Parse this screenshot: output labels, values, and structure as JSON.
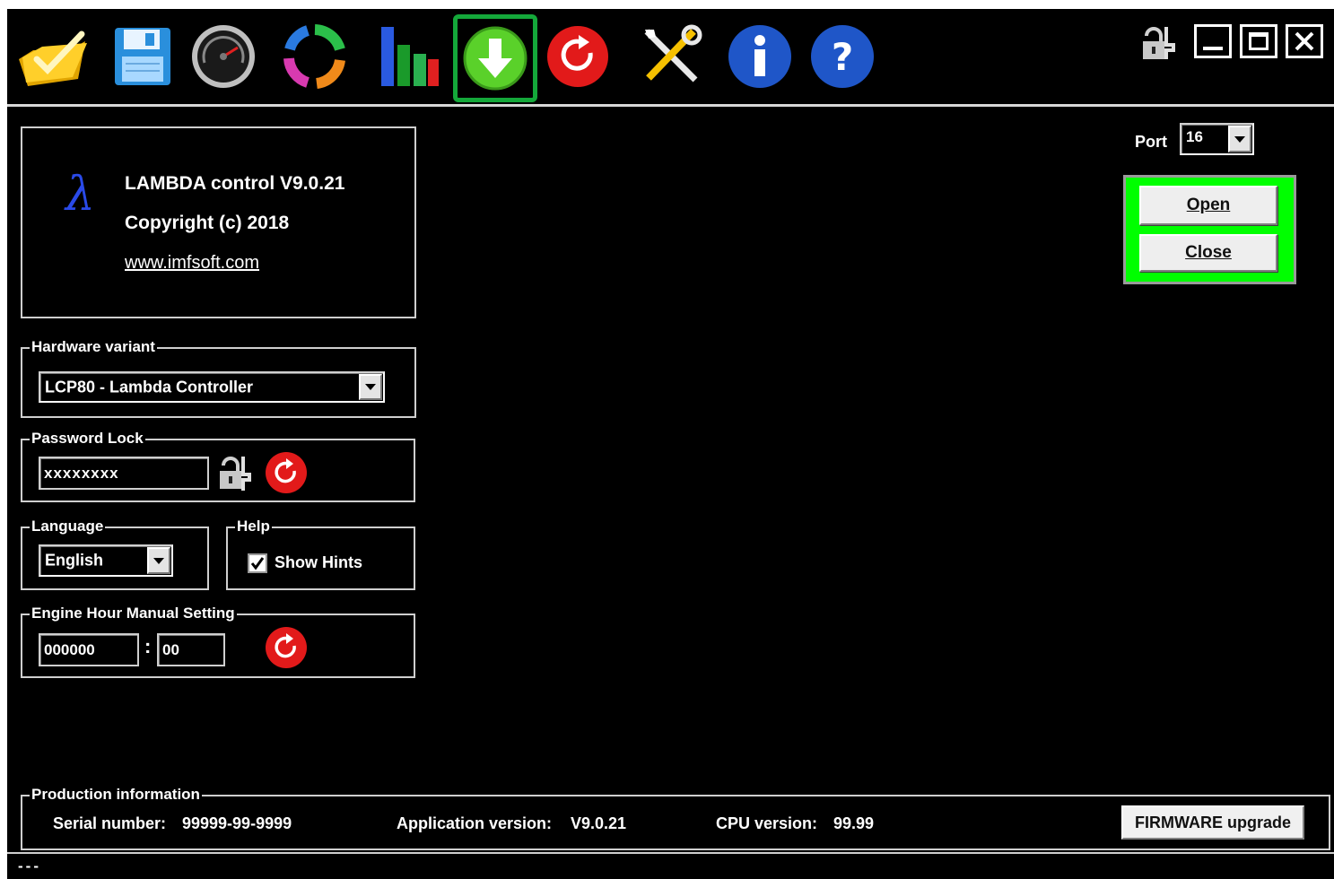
{
  "toolbar": {
    "items": [
      {
        "name": "open-folder",
        "icon": "folder-check-icon"
      },
      {
        "name": "save",
        "icon": "floppy-disk-icon"
      },
      {
        "name": "gauge",
        "icon": "speedometer-icon"
      },
      {
        "name": "refresh",
        "icon": "circular-arrows-icon"
      },
      {
        "name": "chart",
        "icon": "bar-chart-icon"
      },
      {
        "name": "download",
        "icon": "download-arrow-icon"
      },
      {
        "name": "reset",
        "icon": "red-reset-icon"
      },
      {
        "name": "tools",
        "icon": "tools-icon"
      },
      {
        "name": "info",
        "icon": "info-icon"
      },
      {
        "name": "help",
        "icon": "help-icon"
      }
    ],
    "selected": "download"
  },
  "window_controls": {
    "lock_icon": "lock-key-icon",
    "minimize_icon": "minimize-icon",
    "maximize_icon": "maximize-icon",
    "close_icon": "close-icon"
  },
  "about": {
    "symbol": "λ",
    "title": "LAMBDA control  V9.0.21",
    "copyright": "Copyright (c) 2018",
    "website": "www.imfsoft.com"
  },
  "hardware": {
    "title": "Hardware variant",
    "selected": "LCP80 - Lambda Controller"
  },
  "password": {
    "title": "Password Lock",
    "value": "xxxxxxxx"
  },
  "language": {
    "title": "Language",
    "selected": "English"
  },
  "help": {
    "title": "Help",
    "show_hints_label": "Show Hints",
    "show_hints_checked": true
  },
  "engine_hour": {
    "title": "Engine Hour Manual Setting",
    "hours": "000000",
    "separator": ":",
    "minutes": "00"
  },
  "port": {
    "label": "Port",
    "selected": "16"
  },
  "connection": {
    "open_label": "Open",
    "close_label": "Close"
  },
  "production": {
    "title": "Production information",
    "serial_label": "Serial number:",
    "serial_value": "99999-99-9999",
    "app_version_label": "Application version:",
    "app_version_value": "V9.0.21",
    "cpu_version_label": "CPU version:",
    "cpu_version_value": "99.99",
    "firmware_button": "FIRMWARE upgrade"
  },
  "status": {
    "text": "---"
  },
  "colors": {
    "background": "#000000",
    "highlight_green": "#00ff00",
    "selected_border": "#14a83a"
  }
}
